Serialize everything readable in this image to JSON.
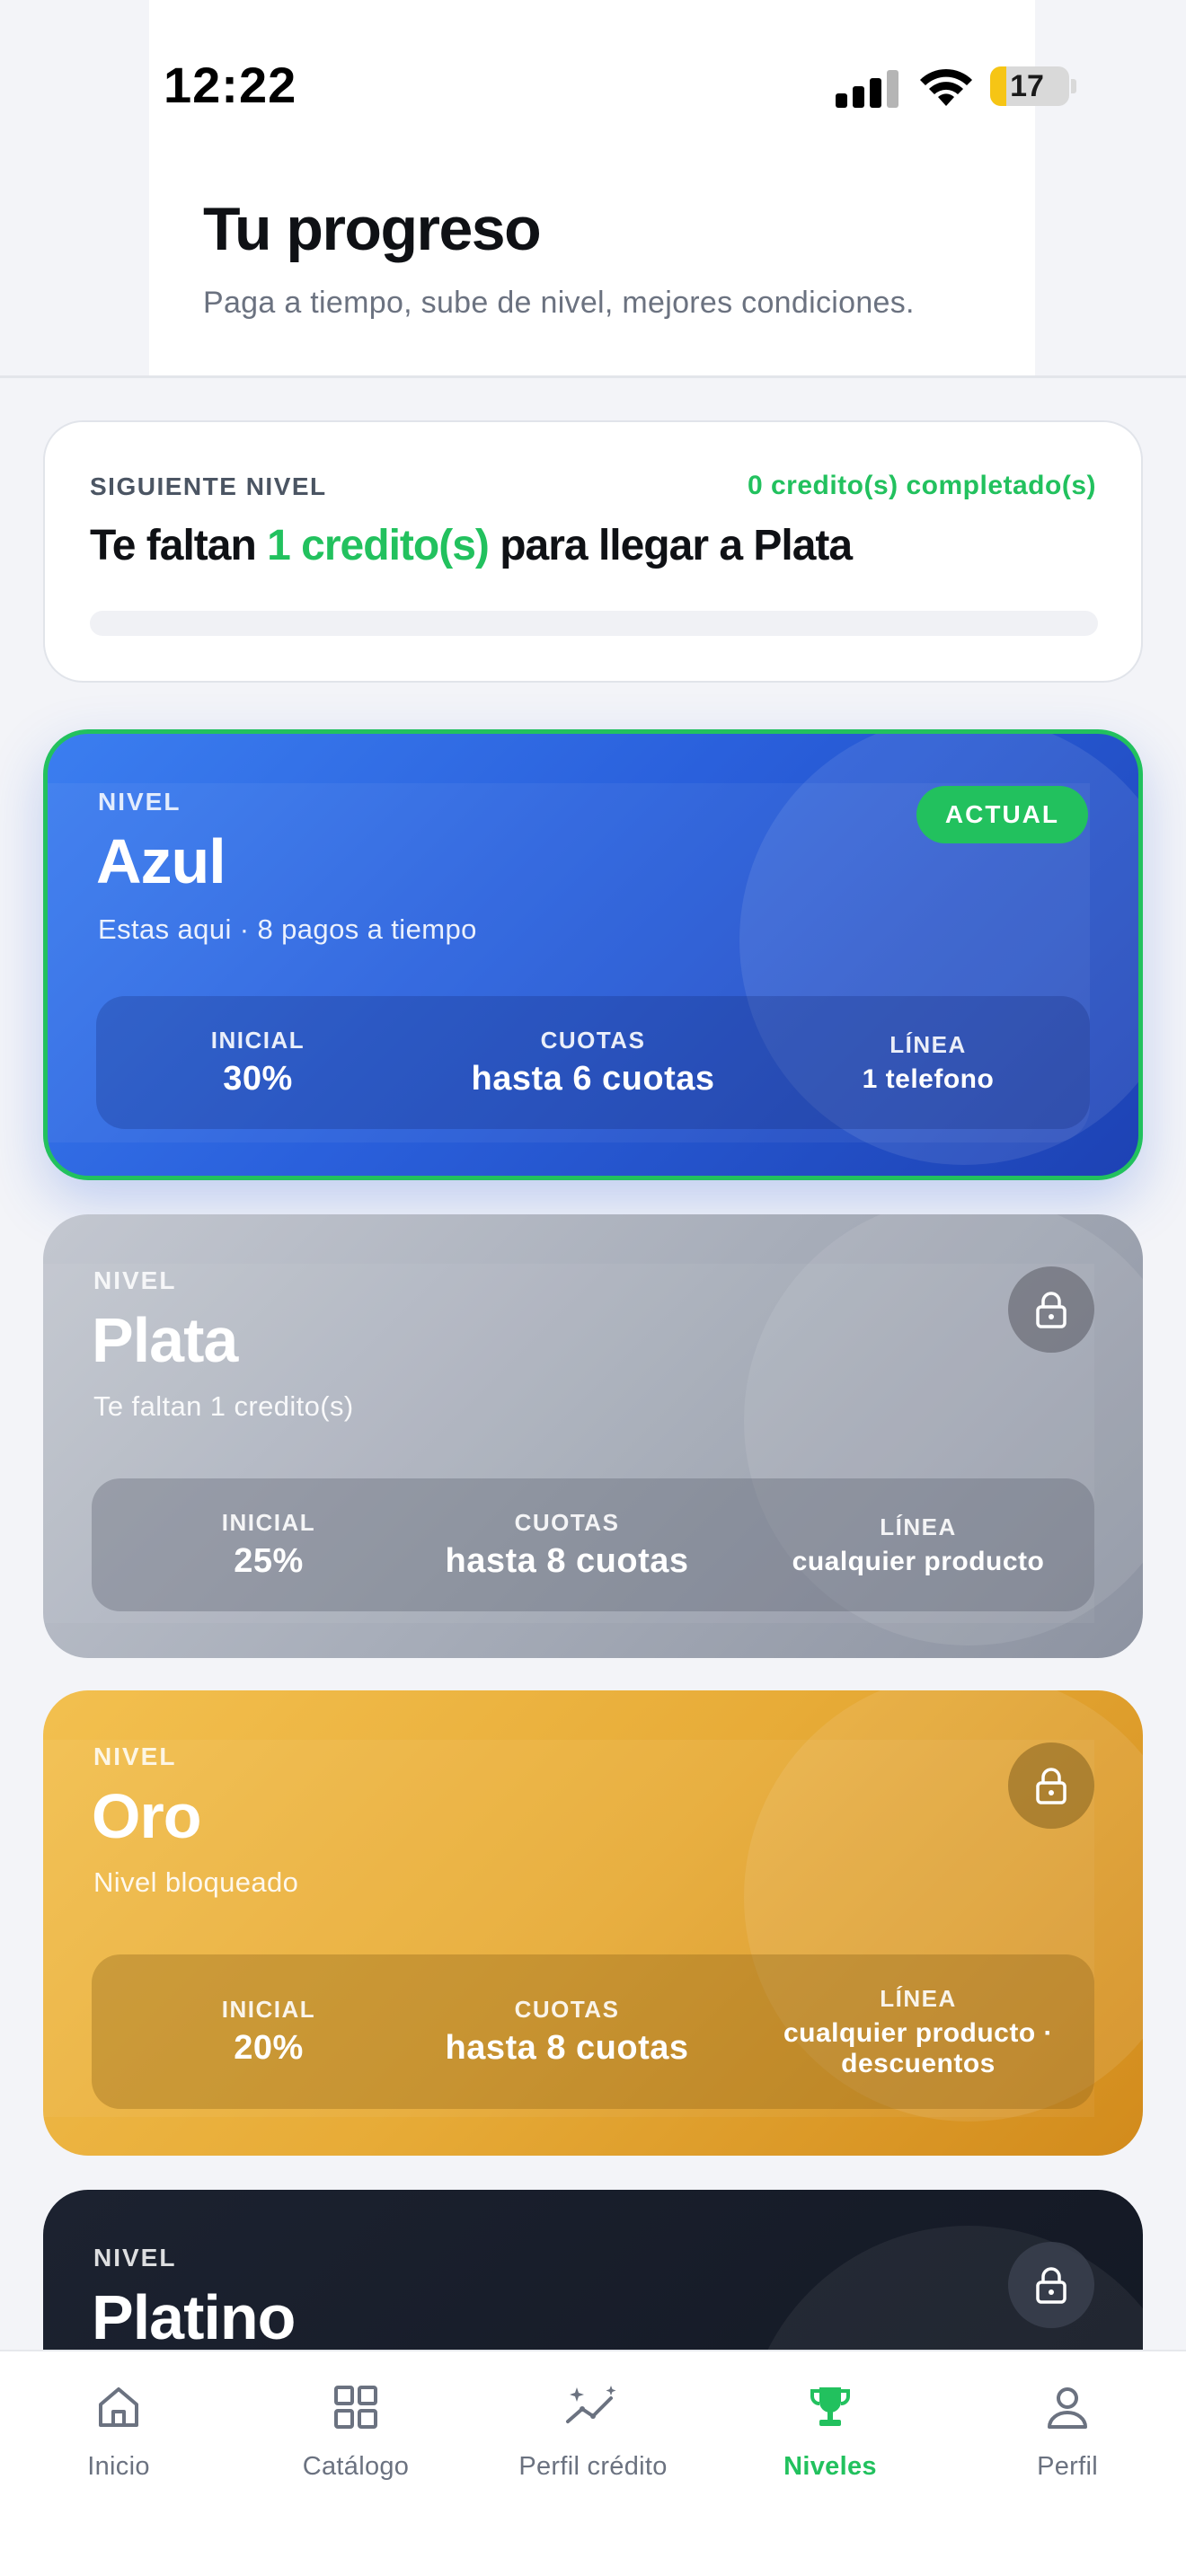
{
  "status_bar": {
    "time": "12:22",
    "battery": "17",
    "icons": [
      "signal-icon",
      "wifi-icon",
      "battery-icon"
    ]
  },
  "header": {
    "title": "Tu progreso",
    "subtitle": "Paga a tiempo, sube de nivel, mejores condiciones."
  },
  "next_level": {
    "label": "SIGUIENTE NIVEL",
    "completed": "0 credito(s) completado(s)",
    "headline_prefix": "Te faltan ",
    "headline_highlight": "1 credito(s)",
    "headline_suffix": " para llegar a Plata",
    "progress": 0
  },
  "levels": [
    {
      "nivel_label": "NIVEL",
      "name": "Azul",
      "description": "Estas aqui · 8 pagos a tiempo",
      "badge": "ACTUAL",
      "stats": [
        {
          "label": "INICIAL",
          "value": "30%"
        },
        {
          "label": "CUOTAS",
          "value": "hasta 6 cuotas"
        },
        {
          "label": "LÍNEA",
          "value": "1 telefono"
        }
      ]
    },
    {
      "nivel_label": "NIVEL",
      "name": "Plata",
      "description": "Te faltan 1 credito(s)",
      "locked": true,
      "stats": [
        {
          "label": "INICIAL",
          "value": "25%"
        },
        {
          "label": "CUOTAS",
          "value": "hasta 8 cuotas"
        },
        {
          "label": "LÍNEA",
          "value": "cualquier producto"
        }
      ]
    },
    {
      "nivel_label": "NIVEL",
      "name": "Oro",
      "description": "Nivel bloqueado",
      "locked": true,
      "stats": [
        {
          "label": "INICIAL",
          "value": "20%"
        },
        {
          "label": "CUOTAS",
          "value": "hasta 8 cuotas"
        },
        {
          "label": "LÍNEA",
          "value": "cualquier producto · descuentos"
        }
      ]
    },
    {
      "nivel_label": "NIVEL",
      "name": "Platino",
      "locked": true
    }
  ],
  "bottom_nav": [
    {
      "label": "Inicio",
      "icon": "home-icon"
    },
    {
      "label": "Catálogo",
      "icon": "grid-icon"
    },
    {
      "label": "Perfil crédito",
      "icon": "trend-sparkle-icon"
    },
    {
      "label": "Niveles",
      "icon": "trophy-icon",
      "active": true
    },
    {
      "label": "Perfil",
      "icon": "user-icon"
    }
  ],
  "colors": {
    "accent_green": "#22c15e",
    "azul": "#2a60dc",
    "plata": "#a7adb9",
    "oro": "#e7ab37",
    "platino": "#161b27"
  }
}
